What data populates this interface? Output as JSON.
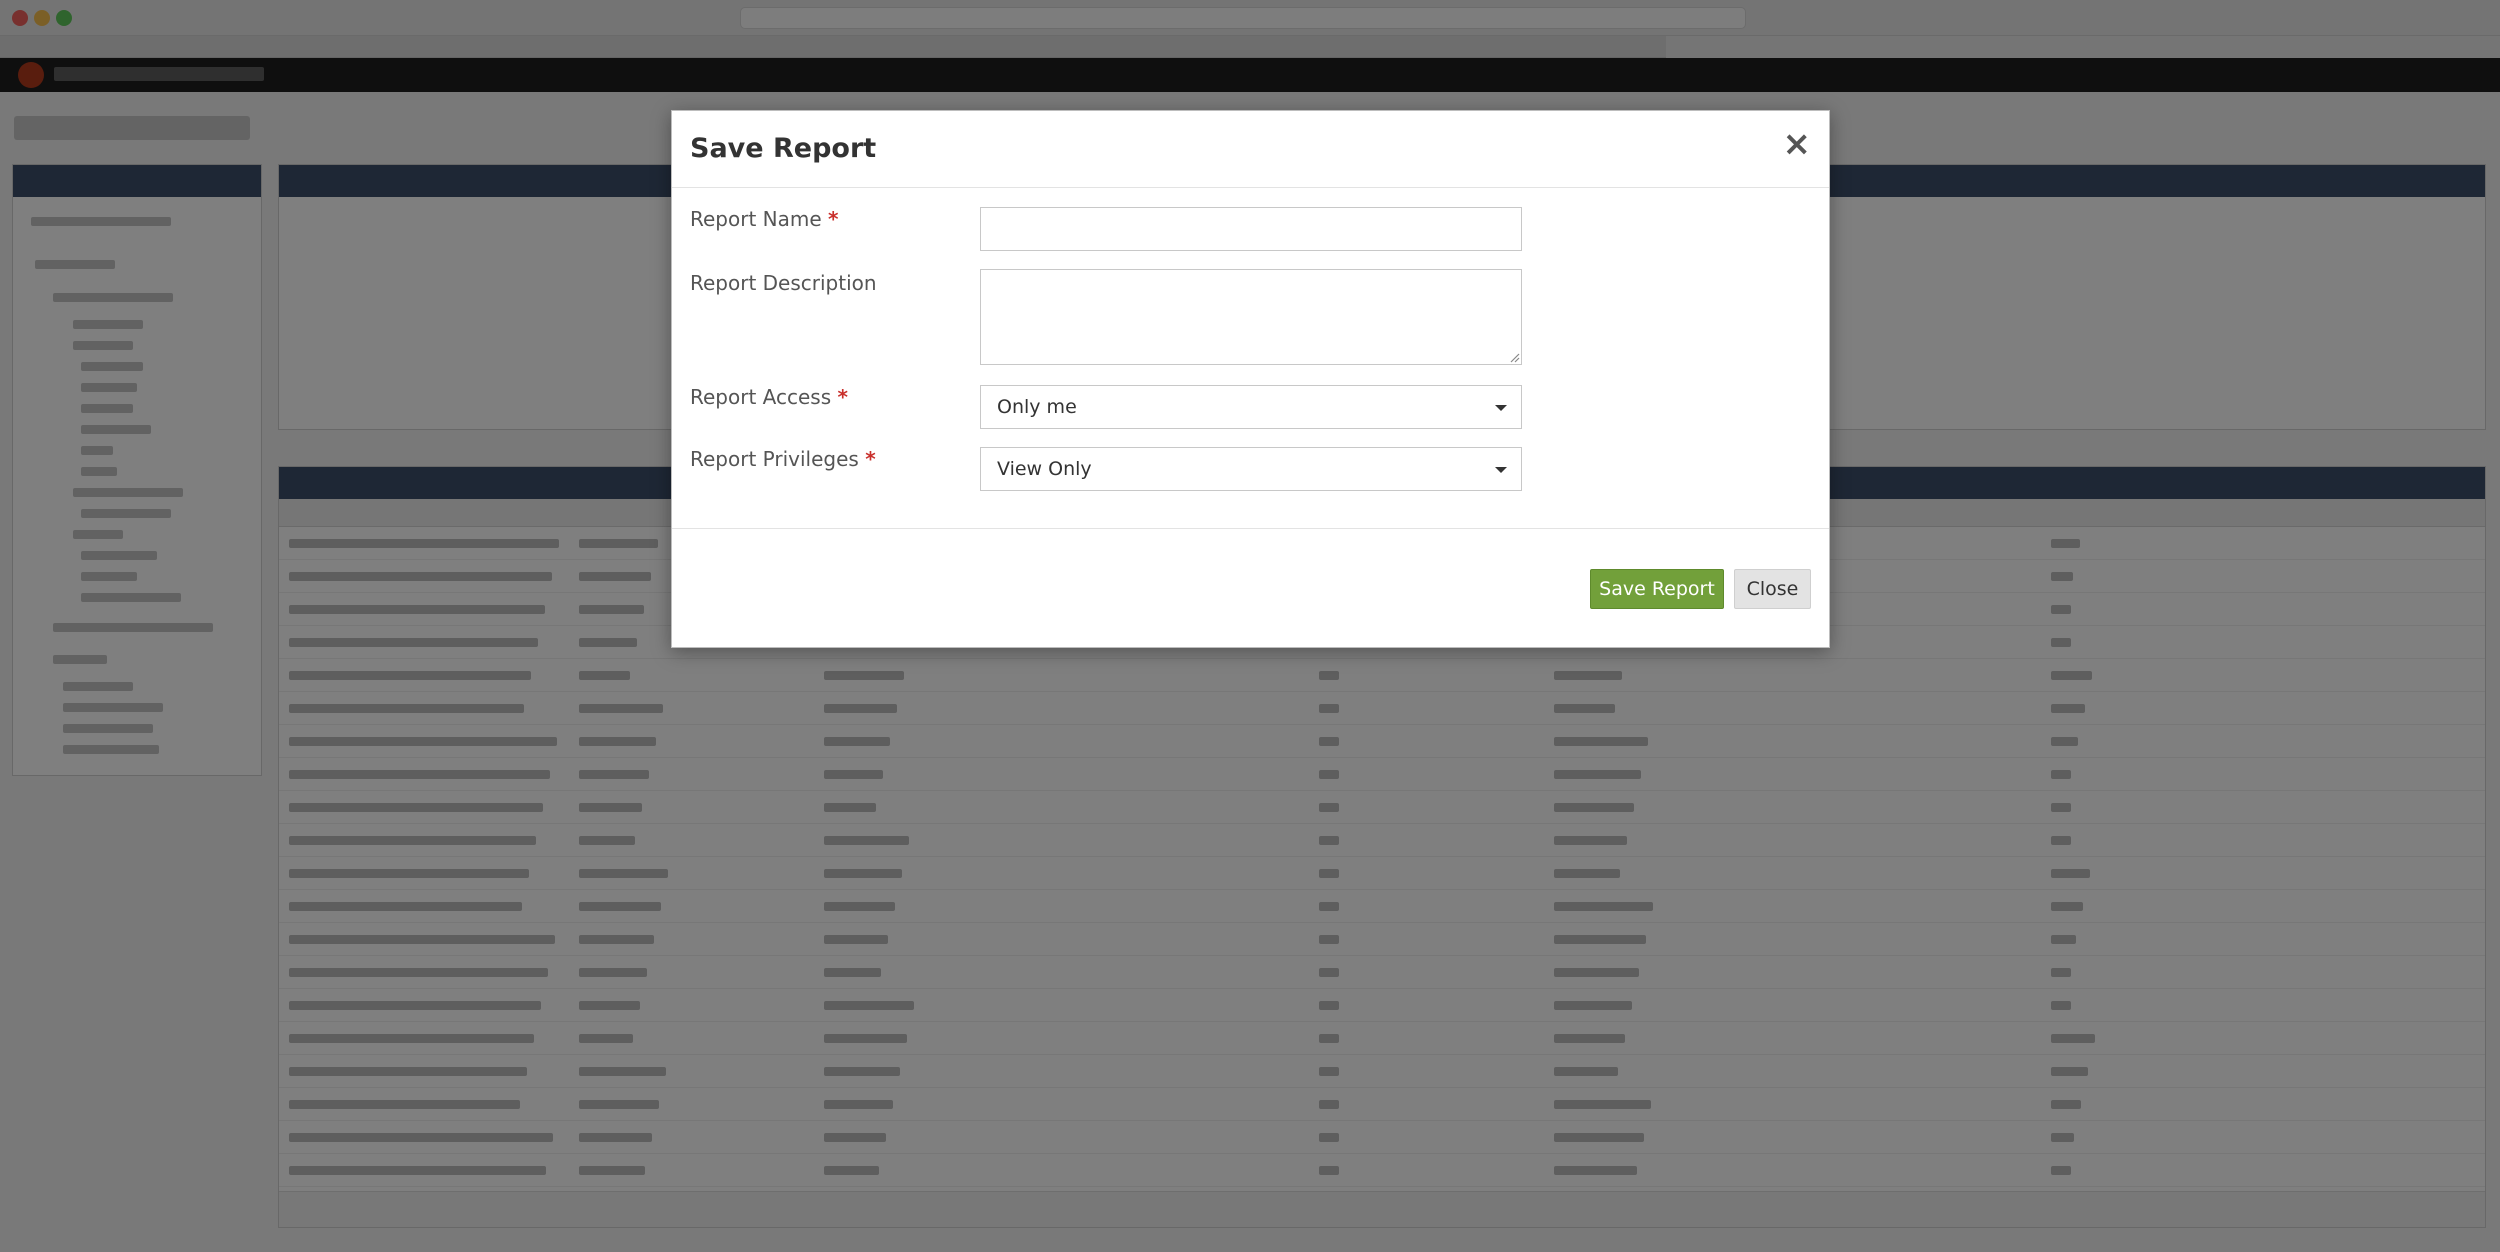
{
  "modal": {
    "title": "Save Report",
    "close_glyph": "×",
    "fields": {
      "report_name": {
        "label": "Report Name",
        "required_mark": "*",
        "value": "",
        "placeholder": ""
      },
      "report_description": {
        "label": "Report Description",
        "value": "",
        "placeholder": ""
      },
      "report_access": {
        "label": "Report Access",
        "required_mark": "*",
        "selected": "Only me"
      },
      "report_privileges": {
        "label": "Report Privileges",
        "required_mark": "*",
        "selected": "View Only"
      }
    },
    "buttons": {
      "save_label": "Save Report",
      "close_label": "Close"
    }
  },
  "colors": {
    "save_button": "#72a03a",
    "required_mark": "#c9302c",
    "app_header": "#1f1f1f",
    "panel_header": "#3d4f6a"
  },
  "icons": {
    "close": "close-icon",
    "dropdown": "chevron-down-icon"
  }
}
